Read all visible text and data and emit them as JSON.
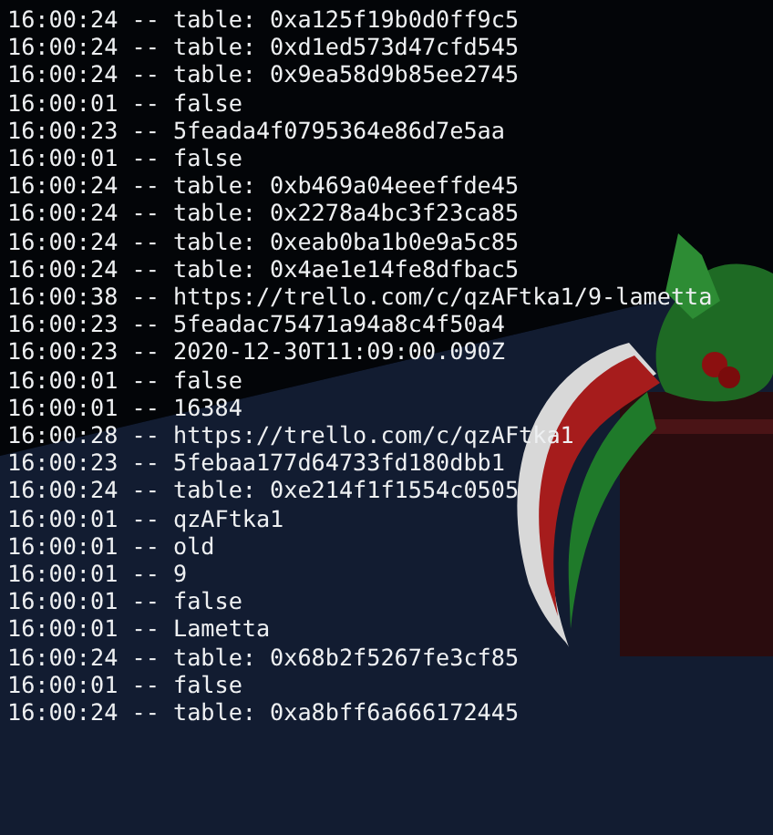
{
  "console": {
    "lines": [
      "16:00:24 -- table: 0xa125f19b0d0ff9c5",
      "16:00:24 -- table: 0xd1ed573d47cfd545",
      "16:00:24 -- table: 0x9ea58d9b85ee2745",
      "16:00:01 -- false",
      "16:00:23 -- 5feada4f0795364e86d7e5aa",
      "16:00:01 -- false",
      "16:00:24 -- table: 0xb469a04eeeffde45",
      "16:00:24 -- table: 0x2278a4bc3f23ca85",
      "16:00:24 -- table: 0xeab0ba1b0e9a5c85",
      "16:00:24 -- table: 0x4ae1e14fe8dfbac5",
      "16:00:38 -- https://trello.com/c/qzAFtka1/9-lametta",
      "16:00:23 -- 5feadac75471a94a8c4f50a4",
      "16:00:23 -- 2020-12-30T11:09:00.090Z",
      "16:00:01 -- false",
      "16:00:01 -- 16384",
      "16:00:28 -- https://trello.com/c/qzAFtka1",
      "16:00:23 -- 5febaa177d64733fd180dbb1",
      "16:00:24 -- table: 0xe214f1f1554c0505",
      "16:00:01 -- qzAFtka1",
      "16:00:01 -- old",
      "16:00:01 -- 9",
      "16:00:01 -- false",
      "16:00:01 -- Lametta",
      "16:00:24 -- table: 0x68b2f5267fe3cf85",
      "16:00:01 -- false",
      "16:00:24 -- table: 0xa8bff6a666172445"
    ]
  }
}
